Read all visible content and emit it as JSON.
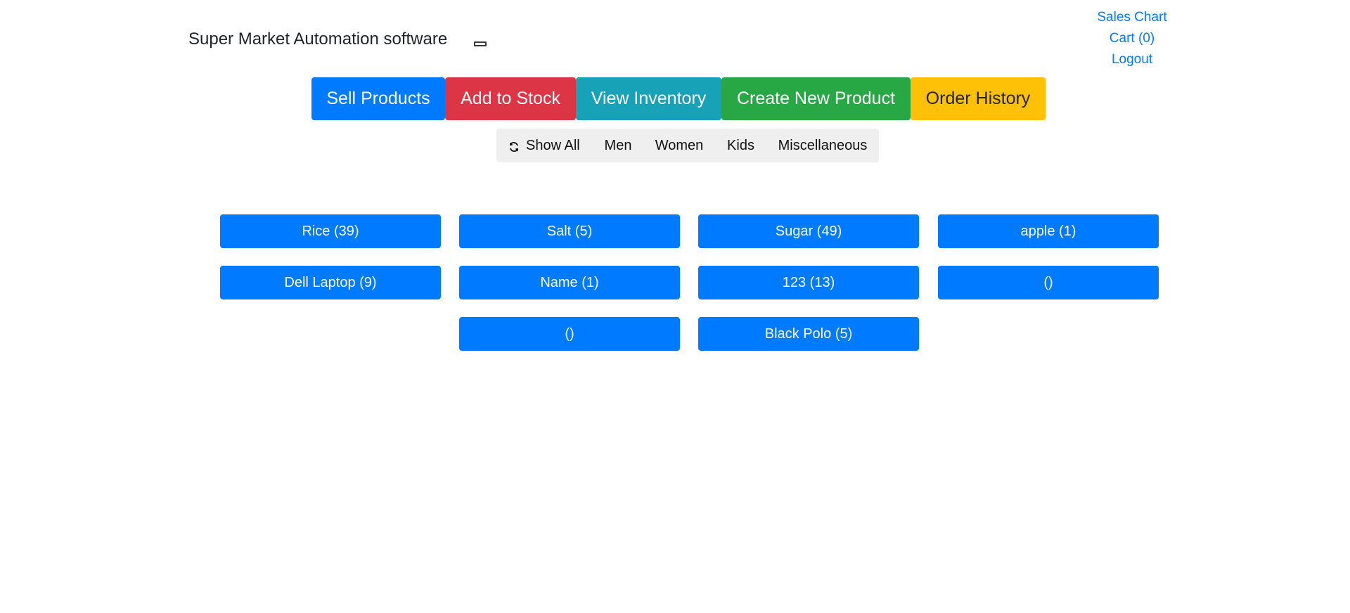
{
  "header": {
    "title": "Super Market Automation software",
    "toggle_icon": "minimize-icon"
  },
  "top_links": {
    "sales_chart": "Sales Chart",
    "cart": "Cart (0)",
    "logout": "Logout"
  },
  "main_nav": {
    "sell": "Sell Products",
    "stock": "Add to Stock",
    "inventory": "View Inventory",
    "create": "Create New Product",
    "history": "Order History"
  },
  "filters": {
    "show_all": "Show All",
    "show_all_icon": "refresh-icon",
    "men": "Men",
    "women": "Women",
    "kids": "Kids",
    "misc": "Miscellaneous"
  },
  "products": [
    "Rice (39)",
    "Salt (5)",
    "Sugar (49)",
    "apple (1)",
    "Dell Laptop (9)",
    "Name (1)",
    "123 (13)",
    "()",
    "()",
    "Black Polo (5)"
  ],
  "colors": {
    "primary": "#007bff",
    "danger": "#dc3545",
    "info": "#17a2b8",
    "success": "#28a745",
    "warning": "#ffc107",
    "filter_bg": "#efefef"
  }
}
